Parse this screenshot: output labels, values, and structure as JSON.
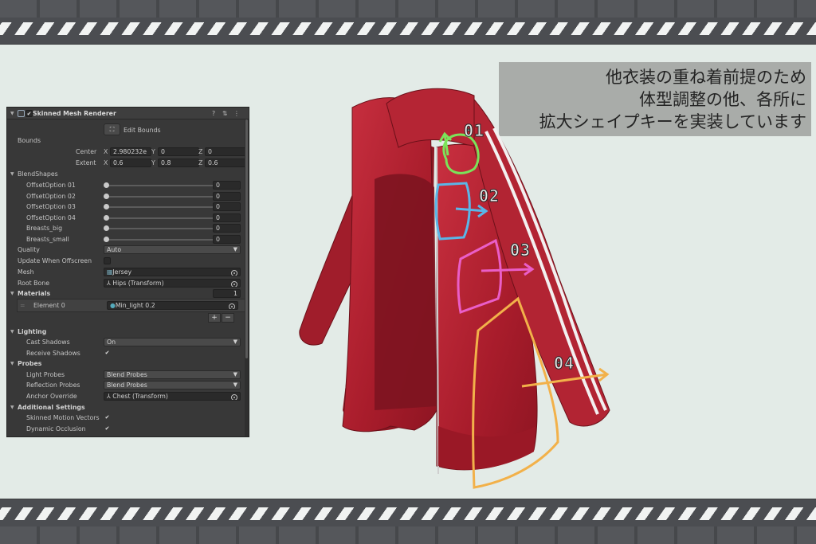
{
  "callout": {
    "lines": [
      "他衣装の重ね着前提のため",
      "体型調整の他、各所に",
      "拡大シェイプキーを実装しています"
    ]
  },
  "labels": [
    "01",
    "02",
    "03",
    "04"
  ],
  "colors": {
    "label_01": "#7be35a",
    "label_02": "#5ab6e8",
    "label_03": "#ea5ec8",
    "label_04": "#f2b14a",
    "jacket": "#b42130"
  },
  "inspector": {
    "component_title": "Skinned Mesh Renderer",
    "edit_bounds": "Edit Bounds",
    "bounds_label": "Bounds",
    "center_label": "Center",
    "extent_label": "Extent",
    "center": {
      "x": "2.980232e",
      "y": "0",
      "z": "0"
    },
    "extent": {
      "x": "0.6",
      "y": "0.8",
      "z": "0.6"
    },
    "axis": {
      "x": "X",
      "y": "Y",
      "z": "Z"
    },
    "blendshapes_label": "BlendShapes",
    "blendshapes": [
      {
        "name": "OffsetOption 01",
        "value": "0"
      },
      {
        "name": "OffsetOption 02",
        "value": "0"
      },
      {
        "name": "OffsetOption 03",
        "value": "0"
      },
      {
        "name": "OffsetOption 04",
        "value": "0"
      },
      {
        "name": "Breasts_big",
        "value": "0"
      },
      {
        "name": "Breasts_small",
        "value": "0"
      }
    ],
    "quality_label": "Quality",
    "quality_value": "Auto",
    "update_offscreen_label": "Update When Offscreen",
    "mesh_label": "Mesh",
    "mesh_value": "Jersey",
    "root_bone_label": "Root Bone",
    "root_bone_value": "Hips (Transform)",
    "materials_label": "Materials",
    "materials_count": "1",
    "element0_label": "Element 0",
    "element0_value": "Min_light 0.2",
    "plus": "+",
    "minus": "−",
    "lighting_label": "Lighting",
    "cast_shadows_label": "Cast Shadows",
    "cast_shadows_value": "On",
    "receive_shadows_label": "Receive Shadows",
    "probes_label": "Probes",
    "light_probes_label": "Light Probes",
    "light_probes_value": "Blend Probes",
    "reflection_probes_label": "Reflection Probes",
    "reflection_probes_value": "Blend Probes",
    "anchor_override_label": "Anchor Override",
    "anchor_override_value": "Chest (Transform)",
    "additional_label": "Additional Settings",
    "skinned_motion_label": "Skinned Motion Vectors",
    "dynamic_occlusion_label": "Dynamic Occlusion",
    "check": "✔"
  }
}
